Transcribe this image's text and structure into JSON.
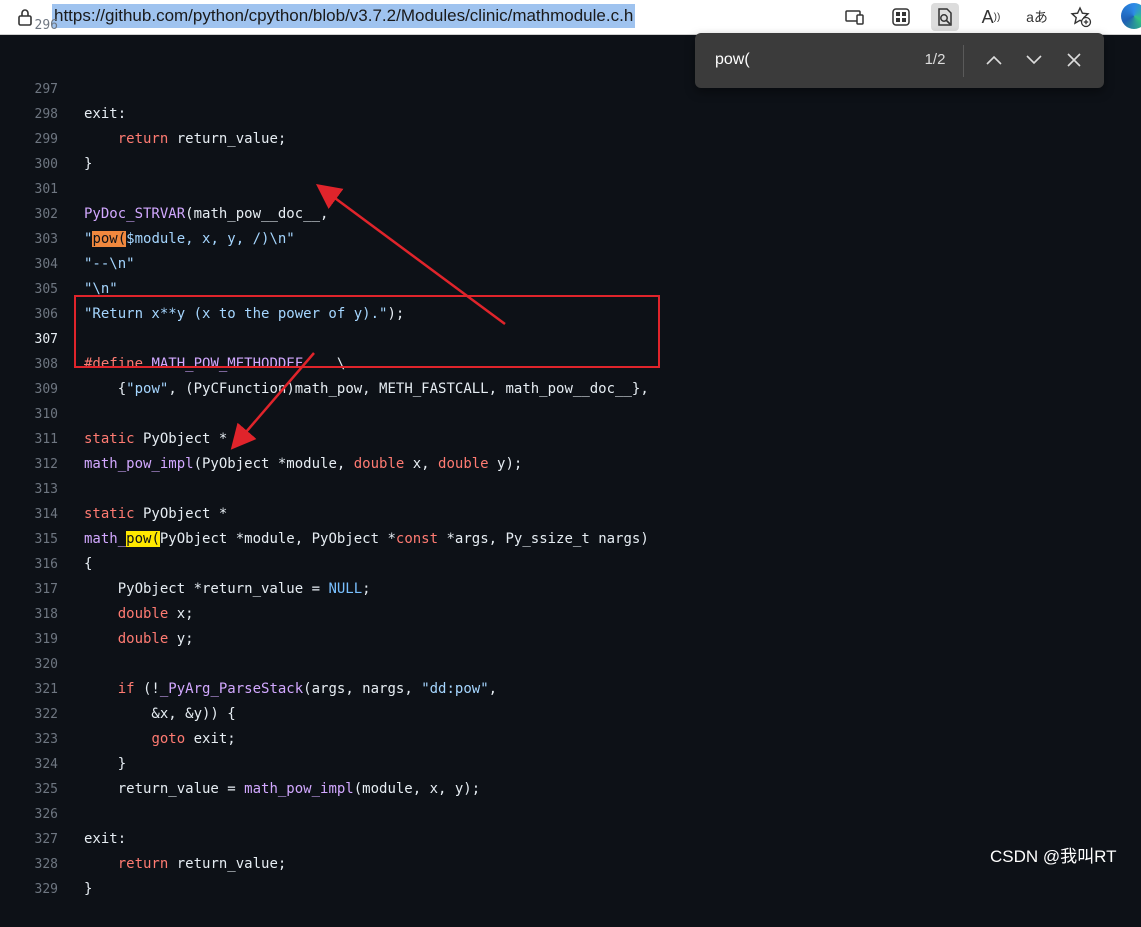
{
  "browser": {
    "url": "https://github.com/python/cpython/blob/v3.7.2/Modules/clinic/mathmodule.c.h",
    "toolbar_icons": [
      "lock-icon",
      "app-available-icon",
      "split-screen-icon",
      "find-in-page-icon",
      "read-aloud-icon",
      "translate-icon",
      "favorites-add-icon",
      "edge-profile-icon"
    ],
    "read_aloud_glyph": "A",
    "translate_glyph": "aあ"
  },
  "find_bar": {
    "query": "pow(",
    "count": "1/2",
    "buttons": [
      "previous-match",
      "next-match",
      "close"
    ]
  },
  "colors": {
    "keyword": "#ff7b72",
    "function": "#d2a8ff",
    "string": "#a5d6ff",
    "constant": "#79c0ff",
    "current_match_highlight": "#f0883e",
    "match_highlight": "#ffe800",
    "annotation": "#e0242b"
  },
  "code": {
    "lines": [
      {
        "n": "297",
        "t": "exit:"
      },
      {
        "n": "298",
        "t": "    return return_value;"
      },
      {
        "n": "299",
        "t": "}"
      },
      {
        "n": "300",
        "t": ""
      },
      {
        "n": "301",
        "t": "PyDoc_STRVAR(math_pow__doc__,"
      },
      {
        "n": "302",
        "t": "\"pow($module, x, y, /)\\n\""
      },
      {
        "n": "303",
        "t": "\"--\\n\""
      },
      {
        "n": "304",
        "t": "\"\\n\""
      },
      {
        "n": "305",
        "t": "\"Return x**y (x to the power of y).\");"
      },
      {
        "n": "306",
        "t": ""
      },
      {
        "n": "307",
        "t": "#define MATH_POW_METHODDEF    \\"
      },
      {
        "n": "308",
        "t": "    {\"pow\", (PyCFunction)math_pow, METH_FASTCALL, math_pow__doc__},"
      },
      {
        "n": "309",
        "t": ""
      },
      {
        "n": "310",
        "t": "static PyObject *"
      },
      {
        "n": "311",
        "t": "math_pow_impl(PyObject *module, double x, double y);"
      },
      {
        "n": "312",
        "t": ""
      },
      {
        "n": "313",
        "t": "static PyObject *"
      },
      {
        "n": "314",
        "t": "math_pow(PyObject *module, PyObject *const *args, Py_ssize_t nargs)"
      },
      {
        "n": "315",
        "t": "{"
      },
      {
        "n": "316",
        "t": "    PyObject *return_value = NULL;"
      },
      {
        "n": "317",
        "t": "    double x;"
      },
      {
        "n": "318",
        "t": "    double y;"
      },
      {
        "n": "319",
        "t": ""
      },
      {
        "n": "320",
        "t": "    if (!_PyArg_ParseStack(args, nargs, \"dd:pow\","
      },
      {
        "n": "321",
        "t": "        &x, &y)) {"
      },
      {
        "n": "322",
        "t": "        goto exit;"
      },
      {
        "n": "323",
        "t": "    }"
      },
      {
        "n": "324",
        "t": "    return_value = math_pow_impl(module, x, y);"
      },
      {
        "n": "325",
        "t": ""
      },
      {
        "n": "326",
        "t": "exit:"
      },
      {
        "n": "327",
        "t": "    return return_value;"
      },
      {
        "n": "328",
        "t": "}"
      },
      {
        "n": "329",
        "t": ""
      }
    ]
  },
  "watermark": "CSDN @我叫RT"
}
